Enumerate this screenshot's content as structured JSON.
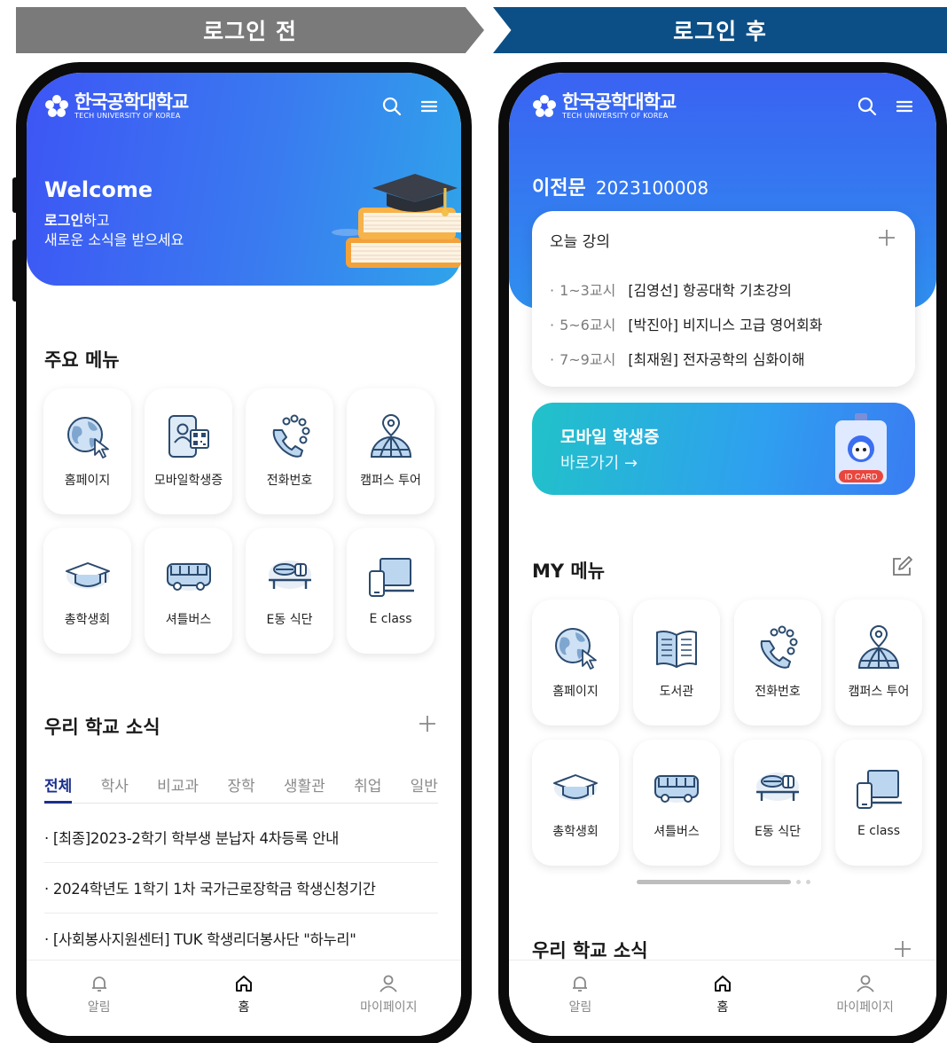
{
  "banners": {
    "before": "로그인 전",
    "after": "로그인 후"
  },
  "brand": {
    "name_kr": "한국공학대학교",
    "name_en": "TECH UNIVERSITY OF KOREA"
  },
  "left": {
    "welcome": "Welcome",
    "login_link": "로그인",
    "login_suffix": "하고",
    "login_line2": "새로운 소식을 받으세요",
    "main_menu_title": "주요 메뉴",
    "menu": [
      {
        "label": "홈페이지",
        "icon": "globe-cursor-icon"
      },
      {
        "label": "모바일학생증",
        "icon": "phone-id-icon"
      },
      {
        "label": "전화번호",
        "icon": "phone-call-icon"
      },
      {
        "label": "캠퍼스 투어",
        "icon": "map-pin-globe-icon"
      },
      {
        "label": "총학생회",
        "icon": "graduation-cap-icon"
      },
      {
        "label": "셔틀버스",
        "icon": "bus-icon"
      },
      {
        "label": "E동 식단",
        "icon": "food-tray-icon"
      },
      {
        "label": "E class",
        "icon": "laptop-phone-icon"
      }
    ],
    "news_title": "우리 학교 소식",
    "tabs": [
      "전체",
      "학사",
      "비교과",
      "장학",
      "생활관",
      "취업",
      "일반"
    ],
    "news": [
      "· [최종]2023-2학기 학부생 분납자 4차등록 안내",
      "· 2024학년도 1학기 1차 국가근로장학금 학생신청기간",
      "· [사회봉사지원센터] TUK 학생리더봉사단 \"하누리\""
    ]
  },
  "right": {
    "student_name": "이전문",
    "student_id": "2023100008",
    "lecture_title": "오늘 강의",
    "lectures": [
      {
        "period": "1~3교시",
        "course": "[김영선] 항공대학 기초강의"
      },
      {
        "period": "5~6교시",
        "course": "[박진아] 비지니스 고급 영어회화"
      },
      {
        "period": "7~9교시",
        "course": "[최재원] 전자공학의 심화이해"
      }
    ],
    "id_card_title": "모바일 학생증",
    "id_card_link": "바로가기 →",
    "id_card_badge": "ID CARD",
    "my_menu_title": "MY 메뉴",
    "menu": [
      {
        "label": "홈페이지",
        "icon": "globe-cursor-icon"
      },
      {
        "label": "도서관",
        "icon": "open-book-icon"
      },
      {
        "label": "전화번호",
        "icon": "phone-call-icon"
      },
      {
        "label": "캠퍼스 투어",
        "icon": "map-pin-globe-icon"
      },
      {
        "label": "총학생회",
        "icon": "graduation-cap-icon"
      },
      {
        "label": "셔틀버스",
        "icon": "bus-icon"
      },
      {
        "label": "E동 식단",
        "icon": "food-tray-icon"
      },
      {
        "label": "E class",
        "icon": "laptop-phone-icon"
      }
    ],
    "news_title": "우리 학교 소식"
  },
  "nav": {
    "alerts": "알림",
    "home": "홈",
    "mypage": "마이페이지"
  },
  "colors": {
    "hero_blue": "#3d55f5",
    "hero_cyan": "#2fa4ea",
    "banner_gray": "#7a7a7a",
    "banner_navy": "#0c4f86",
    "tab_active": "#1a2f8c"
  }
}
